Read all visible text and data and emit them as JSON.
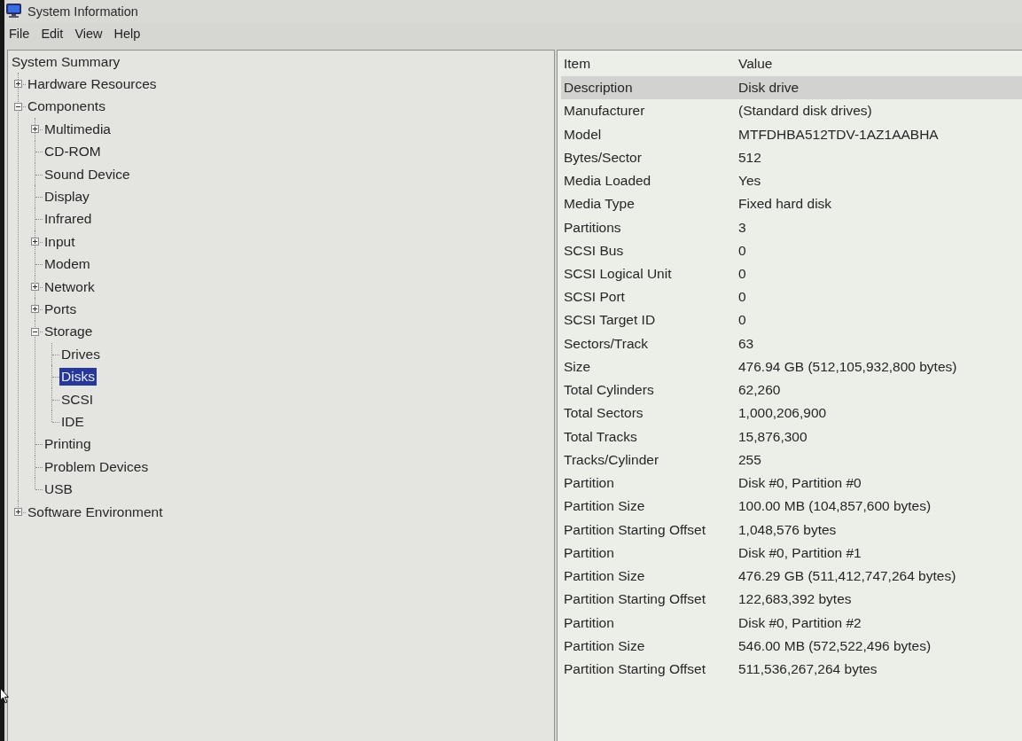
{
  "window": {
    "title": "System Information"
  },
  "menu": [
    "File",
    "Edit",
    "View",
    "Help"
  ],
  "tree": [
    {
      "label": "System Summary",
      "selected": false,
      "children": [
        {
          "label": "Hardware Resources",
          "selected": false,
          "expanded": false
        },
        {
          "label": "Components",
          "selected": false,
          "expanded": true,
          "children": [
            {
              "label": "Multimedia",
              "selected": false,
              "expanded": false
            },
            {
              "label": "CD-ROM",
              "selected": false
            },
            {
              "label": "Sound Device",
              "selected": false
            },
            {
              "label": "Display",
              "selected": false
            },
            {
              "label": "Infrared",
              "selected": false
            },
            {
              "label": "Input",
              "selected": false,
              "expanded": false
            },
            {
              "label": "Modem",
              "selected": false
            },
            {
              "label": "Network",
              "selected": false,
              "expanded": false
            },
            {
              "label": "Ports",
              "selected": false,
              "expanded": false
            },
            {
              "label": "Storage",
              "selected": false,
              "expanded": true,
              "children": [
                {
                  "label": "Drives",
                  "selected": false
                },
                {
                  "label": "Disks",
                  "selected": true
                },
                {
                  "label": "SCSI",
                  "selected": false
                },
                {
                  "label": "IDE",
                  "selected": false
                }
              ]
            },
            {
              "label": "Printing",
              "selected": false
            },
            {
              "label": "Problem Devices",
              "selected": false
            },
            {
              "label": "USB",
              "selected": false
            }
          ]
        },
        {
          "label": "Software Environment",
          "selected": false,
          "expanded": false
        }
      ]
    }
  ],
  "details": {
    "columns": [
      "Item",
      "Value"
    ],
    "rows": [
      {
        "item": "Description",
        "value": "Disk drive",
        "selected": true
      },
      {
        "item": "Manufacturer",
        "value": "(Standard disk drives)",
        "selected": false
      },
      {
        "item": "Model",
        "value": "MTFDHBA512TDV-1AZ1AABHA",
        "selected": false
      },
      {
        "item": "Bytes/Sector",
        "value": "512",
        "selected": false
      },
      {
        "item": "Media Loaded",
        "value": "Yes",
        "selected": false
      },
      {
        "item": "Media Type",
        "value": "Fixed hard disk",
        "selected": false
      },
      {
        "item": "Partitions",
        "value": "3",
        "selected": false
      },
      {
        "item": "SCSI Bus",
        "value": "0",
        "selected": false
      },
      {
        "item": "SCSI Logical Unit",
        "value": "0",
        "selected": false
      },
      {
        "item": "SCSI Port",
        "value": "0",
        "selected": false
      },
      {
        "item": "SCSI Target ID",
        "value": "0",
        "selected": false
      },
      {
        "item": "Sectors/Track",
        "value": "63",
        "selected": false
      },
      {
        "item": "Size",
        "value": "476.94 GB (512,105,932,800 bytes)",
        "selected": false
      },
      {
        "item": "Total Cylinders",
        "value": "62,260",
        "selected": false
      },
      {
        "item": "Total Sectors",
        "value": "1,000,206,900",
        "selected": false
      },
      {
        "item": "Total Tracks",
        "value": "15,876,300",
        "selected": false
      },
      {
        "item": "Tracks/Cylinder",
        "value": "255",
        "selected": false
      },
      {
        "item": "Partition",
        "value": "Disk #0, Partition #0",
        "selected": false
      },
      {
        "item": "Partition Size",
        "value": "100.00 MB (104,857,600 bytes)",
        "selected": false
      },
      {
        "item": "Partition Starting Offset",
        "value": "1,048,576 bytes",
        "selected": false
      },
      {
        "item": "Partition",
        "value": "Disk #0, Partition #1",
        "selected": false
      },
      {
        "item": "Partition Size",
        "value": "476.29 GB (511,412,747,264 bytes)",
        "selected": false
      },
      {
        "item": "Partition Starting Offset",
        "value": "122,683,392 bytes",
        "selected": false
      },
      {
        "item": "Partition",
        "value": "Disk #0, Partition #2",
        "selected": false
      },
      {
        "item": "Partition Size",
        "value": "546.00 MB (572,522,496 bytes)",
        "selected": false
      },
      {
        "item": "Partition Starting Offset",
        "value": "511,536,267,264 bytes",
        "selected": false
      }
    ]
  }
}
